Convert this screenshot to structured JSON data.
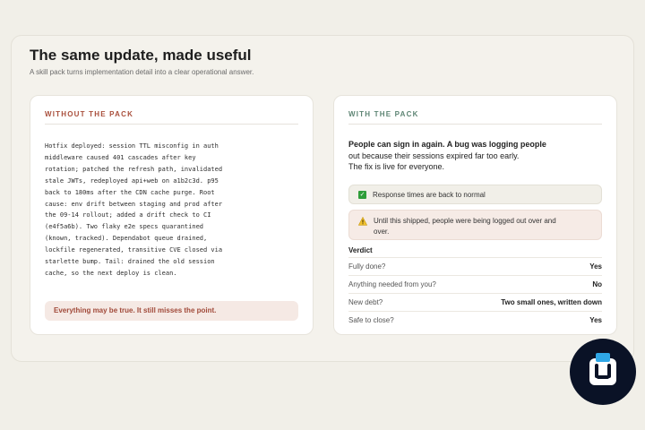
{
  "header": {
    "title": "The same update, made useful",
    "subtitle": "A skill pack turns implementation detail into a clear operational answer."
  },
  "without_pack": {
    "heading": "WITHOUT THE PACK",
    "text": "Hotfix deployed: session TTL misconfig in auth middleware caused 401 cascades after key rotation; patched the refresh path, invalidated stale JWTs, redeployed api+web on a1b2c3d. p95 back to 180ms after the CDN cache purge. Root cause: env drift between staging and prod after the 09-14 rollout; added a drift check to CI (e4f5a6b). Two flaky e2e specs quarantined (known, tracked). Dependabot queue drained, lockfile regenerated, transitive CVE closed via starlette bump. Tail: drained the old session cache, so the next deploy is clean.",
    "note": "Everything may be true. It still misses the point."
  },
  "with_pack": {
    "heading": "WITH THE PACK",
    "headline_bold": "People can sign in again. A bug was logging people",
    "headline_rest": "out because their sessions expired far too early.",
    "headline_line3": "The fix is live for everyone.",
    "status_ok": "Response times are back to normal",
    "status_warn": "Until this shipped, people were being logged out over and over.",
    "verdict_title": "Verdict",
    "verdict": [
      {
        "label": "Fully done?",
        "value": "Yes"
      },
      {
        "label": "Anything needed from you?",
        "value": "No"
      },
      {
        "label": "New debt?",
        "value": "Two small ones, written down"
      },
      {
        "label": "Safe to close?",
        "value": "Yes"
      }
    ]
  },
  "colors": {
    "without_accent": "#a94f3c",
    "with_accent": "#5e8574",
    "ok_green": "#2e9d3a",
    "warn_yellow": "#f2c230"
  },
  "icons": {
    "ok": "check-icon",
    "warn": "warning-icon",
    "badge": "brand-logo-icon"
  }
}
